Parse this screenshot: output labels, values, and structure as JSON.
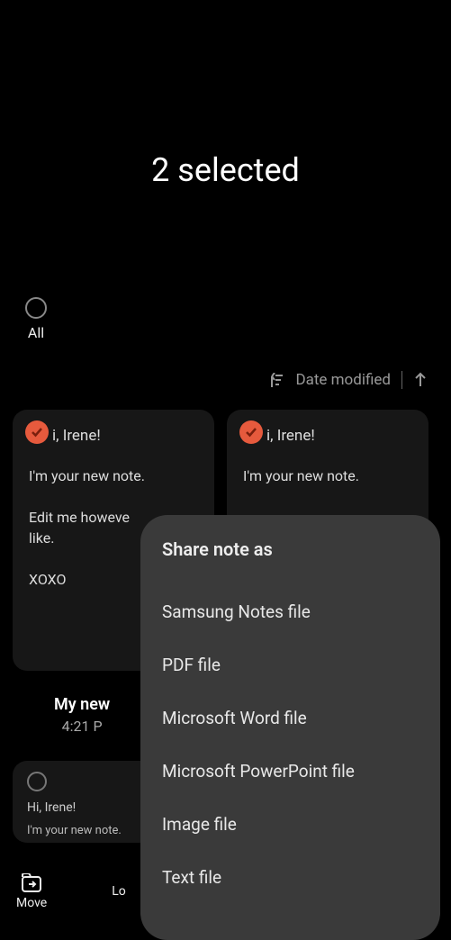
{
  "header": {
    "title": "2 selected"
  },
  "selectAll": {
    "label": "All"
  },
  "sort": {
    "label": "Date modified"
  },
  "cards": [
    {
      "title": "i, Irene!",
      "line1": "I'm your new note.",
      "line2": "Edit me howeve",
      "line3": "like.",
      "line4": "XOXO"
    },
    {
      "title": "i, Irene!",
      "line1": "I'm your new note."
    }
  ],
  "noteLabel": {
    "name": "My new",
    "time": "4:21 P"
  },
  "smallCard": {
    "title": "Hi, Irene!",
    "line1": "I'm your new note."
  },
  "bottomBar": {
    "move": "Move",
    "lock": "Lo"
  },
  "sheet": {
    "title": "Share note as",
    "items": [
      "Samsung Notes file",
      "PDF file",
      "Microsoft Word file",
      "Microsoft PowerPoint file",
      "Image file",
      "Text file"
    ]
  }
}
